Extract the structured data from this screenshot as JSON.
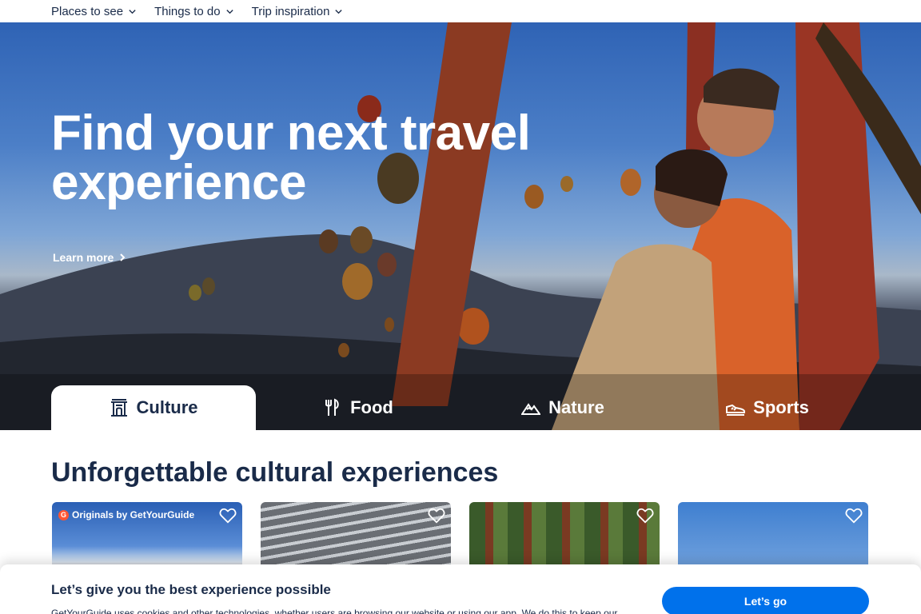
{
  "nav": {
    "items": [
      {
        "label": "Places to see"
      },
      {
        "label": "Things to do"
      },
      {
        "label": "Trip inspiration"
      }
    ]
  },
  "hero": {
    "title": "Find your next travel experience",
    "learn_more": "Learn more"
  },
  "tabs": [
    {
      "label": "Culture",
      "icon": "temple-icon",
      "active": true
    },
    {
      "label": "Food",
      "icon": "fork-knife-icon",
      "active": false
    },
    {
      "label": "Nature",
      "icon": "mountain-icon",
      "active": false
    },
    {
      "label": "Sports",
      "icon": "sneaker-icon",
      "active": false
    }
  ],
  "section": {
    "title": "Unforgettable cultural experiences"
  },
  "cards": [
    {
      "badge": "Originals by GetYourGuide"
    },
    {
      "badge": ""
    },
    {
      "badge": ""
    },
    {
      "badge": ""
    }
  ],
  "cookie": {
    "title": "Let’s give you the best experience possible",
    "text": "GetYourGuide uses cookies and other technologies, whether users are browsing our website or using our app. We do this to keep our",
    "button": "Let’s go"
  },
  "colors": {
    "primary_text": "#1a2b49",
    "accent_button": "#0071eb",
    "badge_logo": "#ff5533"
  }
}
